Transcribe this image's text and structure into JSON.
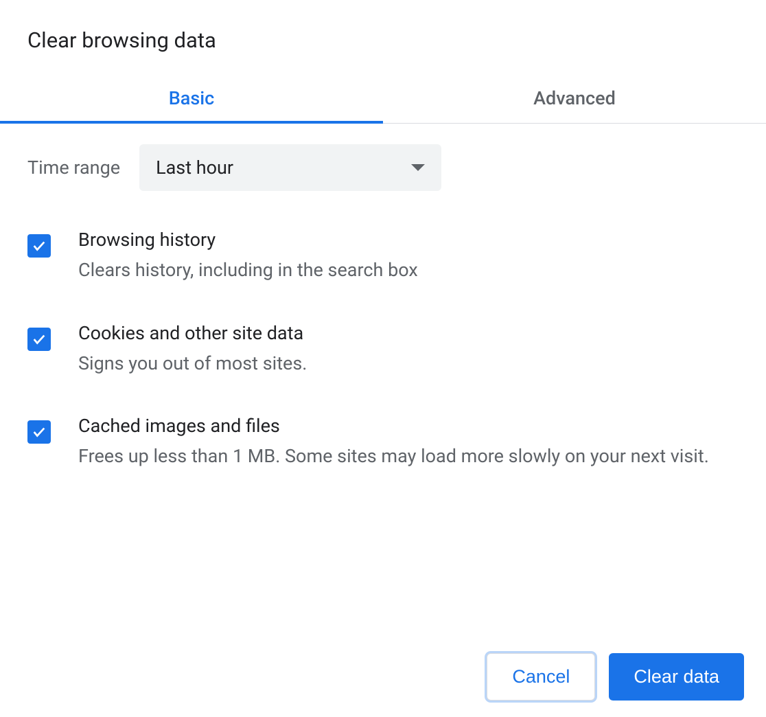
{
  "dialog": {
    "title": "Clear browsing data"
  },
  "tabs": {
    "basic": "Basic",
    "advanced": "Advanced"
  },
  "timeRange": {
    "label": "Time range",
    "selected": "Last hour"
  },
  "options": [
    {
      "title": "Browsing history",
      "description": "Clears history, including in the search box",
      "checked": true
    },
    {
      "title": "Cookies and other site data",
      "description": "Signs you out of most sites.",
      "checked": true
    },
    {
      "title": "Cached images and files",
      "description": "Frees up less than 1 MB. Some sites may load more slowly on your next visit.",
      "checked": true
    }
  ],
  "buttons": {
    "cancel": "Cancel",
    "clear": "Clear data"
  }
}
